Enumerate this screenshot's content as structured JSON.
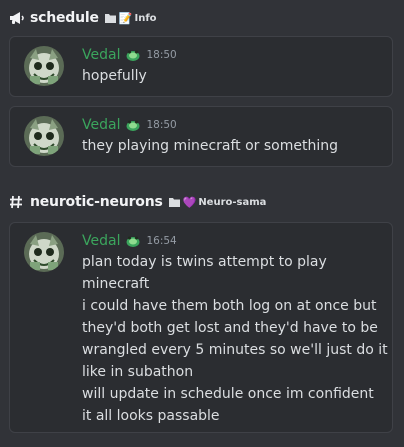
{
  "colors": {
    "background": "#313338",
    "card": "#2b2d31",
    "author": "#3ba55d",
    "timestamp": "#949ba4",
    "text": "#dbdee1"
  },
  "sections": [
    {
      "channel_icon": "megaphone-icon",
      "channel_name": "schedule",
      "meta_icon": "folder-icon",
      "meta_emoji": "📝",
      "meta_label": "Info",
      "messages": [
        {
          "author": "Vedal",
          "badge_icon": "turtle-badge-icon",
          "time": "18:50",
          "lines": [
            "hopefully"
          ]
        },
        {
          "author": "Vedal",
          "badge_icon": "turtle-badge-icon",
          "time": "18:50",
          "lines": [
            "they playing minecraft or something"
          ]
        }
      ]
    },
    {
      "channel_icon": "hash-icon",
      "channel_name": "neurotic-neurons",
      "meta_icon": "folder-icon",
      "meta_emoji": "💜",
      "meta_label": "Neuro-sama",
      "messages": [
        {
          "author": "Vedal",
          "badge_icon": "turtle-badge-icon",
          "time": "16:54",
          "lines": [
            "plan today is twins attempt to play",
            "minecraft",
            "i could have them both log on at once but",
            "they'd both get lost and they'd have to be",
            "wrangled every 5 minutes so we'll just do it",
            "like in subathon",
            "will update in schedule once im confident",
            "it all looks passable"
          ]
        }
      ]
    }
  ]
}
